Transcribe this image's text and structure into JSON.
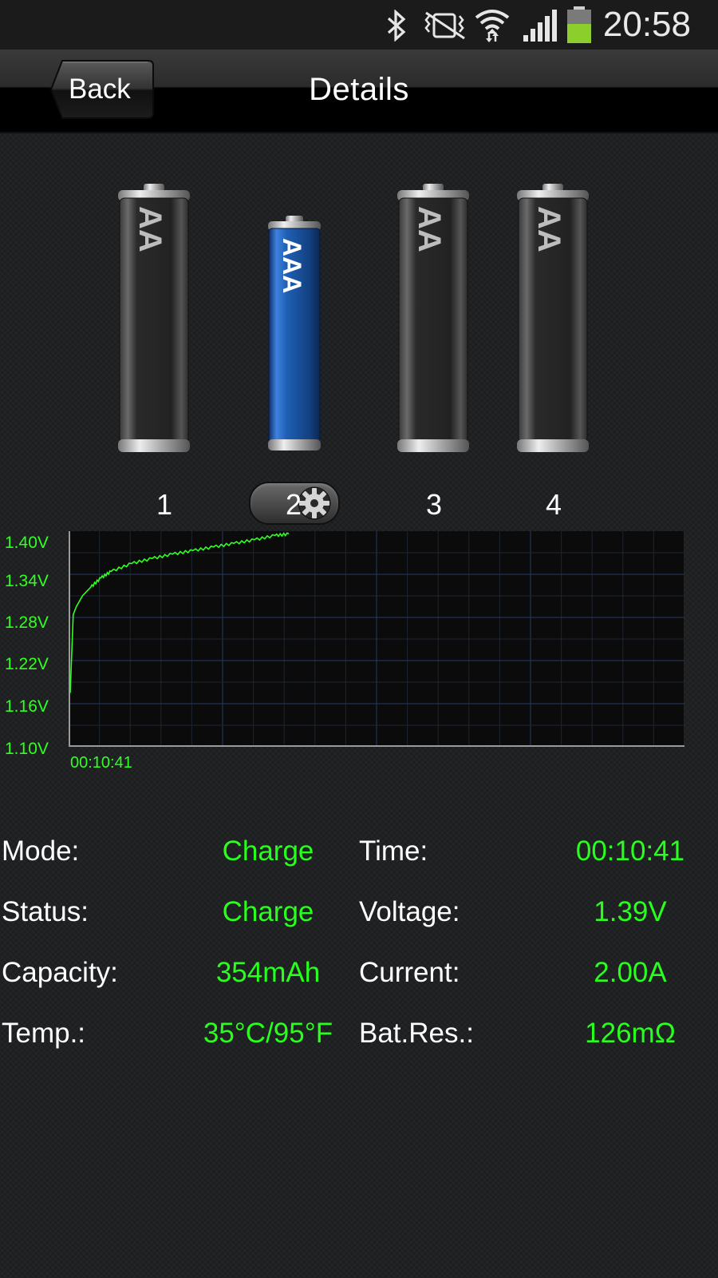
{
  "status_bar": {
    "clock": "20:58",
    "icons": [
      "bluetooth-icon",
      "vibrate-icon",
      "wifi-icon",
      "signal-icon",
      "battery-icon"
    ],
    "battery_color": "#8ccf2c"
  },
  "header": {
    "back_label": "Back",
    "title": "Details"
  },
  "batteries": [
    {
      "slot": "1",
      "type": "AA",
      "selected": false
    },
    {
      "slot": "2",
      "type": "AAA",
      "selected": true
    },
    {
      "slot": "3",
      "type": "AA",
      "selected": false
    },
    {
      "slot": "4",
      "type": "AA",
      "selected": false
    }
  ],
  "accent_colors": {
    "green": "#28ff1c",
    "battery_blue": "#1f5fb5"
  },
  "chart_data": {
    "type": "line",
    "y_ticks": [
      "1.40V",
      "1.34V",
      "1.28V",
      "1.22V",
      "1.16V",
      "1.10V"
    ],
    "x_ticks": [
      "00:10:41"
    ],
    "ylim": [
      1.1,
      1.4
    ],
    "grid": true,
    "series": [
      {
        "color": "#31ff21",
        "x": [
          0,
          0.15,
          0.3,
          0.6,
          1.0,
          1.5,
          2.0,
          3.0,
          4.0,
          5.0,
          6.0,
          7.0,
          8.0,
          9.0,
          10.0,
          10.68
        ],
        "y": [
          1.175,
          1.284,
          1.295,
          1.31,
          1.322,
          1.335,
          1.344,
          1.355,
          1.362,
          1.368,
          1.373,
          1.378,
          1.383,
          1.388,
          1.394,
          1.396
        ]
      }
    ]
  },
  "stats": {
    "mode_label": "Mode:",
    "mode_value": "Charge",
    "time_label": "Time:",
    "time_value": "00:10:41",
    "status_label": "Status:",
    "status_value": "Charge",
    "voltage_label": "Voltage:",
    "voltage_value": "1.39V",
    "capacity_label": "Capacity:",
    "capacity_value": "354mAh",
    "current_label": "Current:",
    "current_value": "2.00A",
    "temp_label": "Temp.:",
    "temp_value": "35°C/95°F",
    "batres_label": "Bat.Res.:",
    "batres_value": "126mΩ"
  }
}
